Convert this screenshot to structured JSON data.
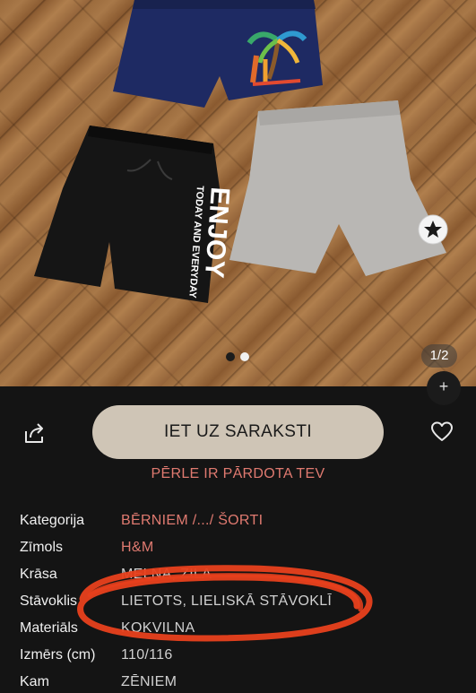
{
  "gallery": {
    "counter": "1/2",
    "current_slide": 1,
    "total_slides": 2,
    "print_text_line1": "ENJOY",
    "print_text_line2": "TODAY AND EVERYDAY"
  },
  "actions": {
    "primary_label": "IET UZ SARAKSTI",
    "sold_note": "PĒRLE IR PĀRDOTA TEV"
  },
  "details": [
    {
      "label": "Kategorija",
      "value": "BĒRNIEM /.../ ŠORTI",
      "link": true
    },
    {
      "label": "Zīmols",
      "value": "H&M",
      "link": true
    },
    {
      "label": "Krāsa",
      "value": "MELNA, ZILA",
      "link": false
    },
    {
      "label": "Stāvoklis",
      "value": "LIETOTS, LIELISKĀ STĀVOKLĪ",
      "link": false
    },
    {
      "label": "Materiāls",
      "value": "KOKVILNA",
      "link": false
    },
    {
      "label": "Izmērs (cm)",
      "value": "110/116",
      "link": false
    },
    {
      "label": "Kam",
      "value": "ZĒNIEM",
      "link": false
    }
  ],
  "colors": {
    "background": "#141414",
    "accent": "#e07a70",
    "primary_button": "#cfc5b6",
    "annotation": "#e8401c"
  },
  "icons": [
    "share-icon",
    "heart-icon",
    "zoom-icon"
  ]
}
